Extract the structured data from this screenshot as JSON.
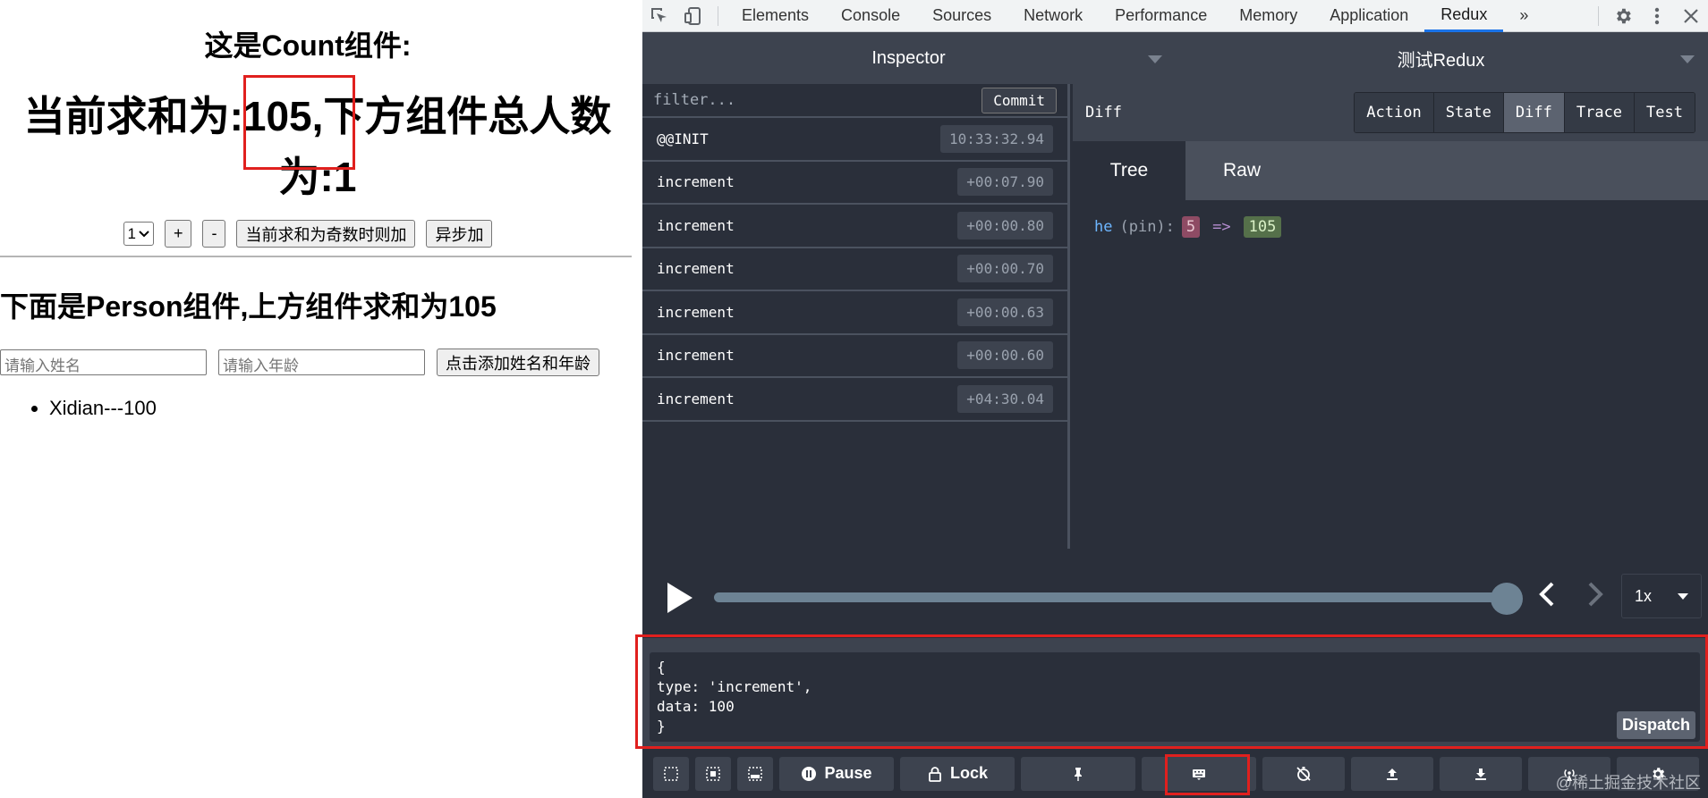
{
  "app": {
    "count_title": "这是Count组件:",
    "sum_line": "当前求和为:105,下方组件总人数为:1",
    "select_value": "1",
    "buttons": {
      "plus": "+",
      "minus": "-",
      "odd": "当前求和为奇数时则加",
      "async": "异步加"
    },
    "person_title": "下面是Person组件,上方组件求和为105",
    "name_placeholder": "请输入姓名",
    "age_placeholder": "请输入年龄",
    "add_button": "点击添加姓名和年龄",
    "persons": [
      "Xidian---100"
    ]
  },
  "devtools": {
    "tabs": [
      "Elements",
      "Console",
      "Sources",
      "Network",
      "Performance",
      "Memory",
      "Application",
      "Redux"
    ],
    "active_tab": "Redux",
    "more": "»",
    "header": {
      "left": "Inspector",
      "right": "测试Redux"
    },
    "filter_placeholder": "filter...",
    "commit": "Commit",
    "actions": [
      {
        "name": "@@INIT",
        "time": "10:33:32.94"
      },
      {
        "name": "increment",
        "time": "+00:07.90"
      },
      {
        "name": "increment",
        "time": "+00:00.80"
      },
      {
        "name": "increment",
        "time": "+00:00.70"
      },
      {
        "name": "increment",
        "time": "+00:00.63"
      },
      {
        "name": "increment",
        "time": "+00:00.60"
      },
      {
        "name": "increment",
        "time": "+04:30.04"
      }
    ],
    "diff_label": "Diff",
    "segments": [
      "Action",
      "State",
      "Diff",
      "Trace",
      "Test"
    ],
    "active_segment": "Diff",
    "tree_tabs": [
      "Tree",
      "Raw"
    ],
    "active_tree_tab": "Tree",
    "diff": {
      "key": "he",
      "pin": "(pin):",
      "old": "5",
      "arrow": "=>",
      "new": "105"
    },
    "slider": {
      "progress": 1.0,
      "speed": "1x"
    },
    "dispatch": {
      "code": "{\ntype: 'increment',\ndata: 100\n}",
      "button": "Dispatch"
    },
    "bottom": {
      "pause": "Pause",
      "lock": "Lock"
    },
    "watermark": "@稀土掘金技术社区"
  }
}
